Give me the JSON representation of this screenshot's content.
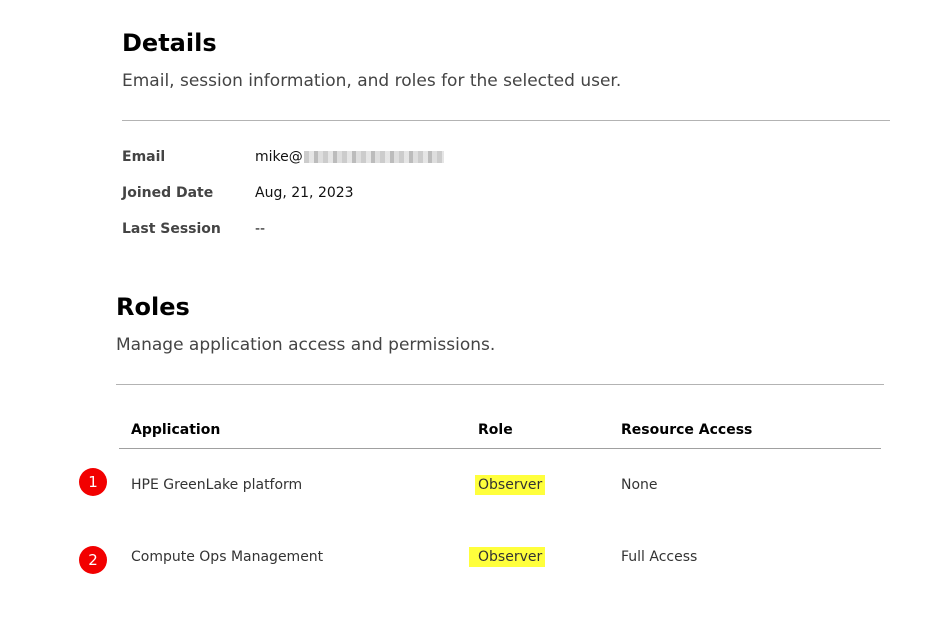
{
  "details": {
    "title": "Details",
    "subtitle": "Email, session information, and roles for the selected user.",
    "fields": [
      {
        "label": "Email",
        "value": "mike@"
      },
      {
        "label": "Joined Date",
        "value": "Aug, 21, 2023"
      },
      {
        "label": "Last Session",
        "value": "--"
      }
    ]
  },
  "roles": {
    "title": "Roles",
    "subtitle": "Manage application access and permissions.",
    "columns": [
      "Application",
      "Role",
      "Resource Access"
    ],
    "rows": [
      {
        "marker": "1",
        "application": "HPE GreenLake platform",
        "role": "Observer",
        "resource_access": "None"
      },
      {
        "marker": "2",
        "application": "Compute Ops Management",
        "role": "Observer",
        "resource_access": "Full Access"
      }
    ]
  },
  "colors": {
    "highlight": "#ffff3c",
    "marker": "#f20000",
    "divider": "#b3b3b3"
  }
}
